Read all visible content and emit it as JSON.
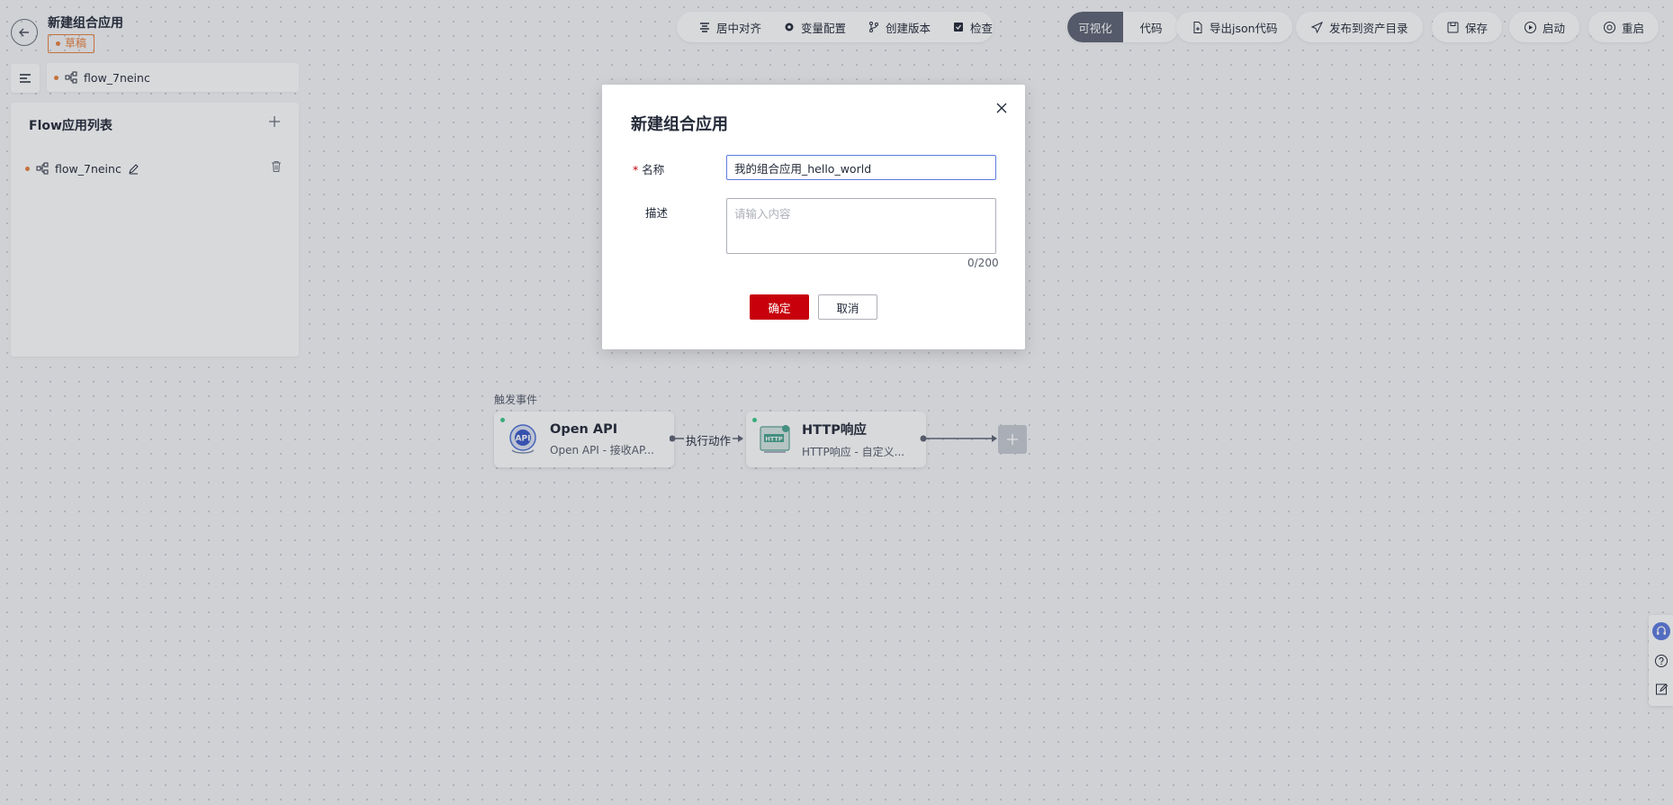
{
  "header": {
    "title": "新建组合应用",
    "status_badge": "草稿"
  },
  "toolbar": {
    "items": [
      {
        "label": "居中对齐",
        "icon": "align-center-icon"
      },
      {
        "label": "变量配置",
        "icon": "gear-icon"
      },
      {
        "label": "创建版本",
        "icon": "branch-icon"
      },
      {
        "label": "检查",
        "icon": "check-doc-icon"
      }
    ]
  },
  "view_toggle": {
    "visual": "可视化",
    "code": "代码",
    "active": "visual"
  },
  "actions": {
    "export_json": "导出json代码",
    "publish": "发布到资产目录",
    "save": "保存",
    "start": "启动",
    "restart": "重启"
  },
  "flow_tab": {
    "name": "flow_7neinc"
  },
  "left_panel": {
    "title": "Flow应用列表",
    "items": [
      {
        "name": "flow_7neinc"
      }
    ]
  },
  "canvas": {
    "trigger_label": "触发事件",
    "nodes": [
      {
        "title": "Open API",
        "subtitle": "Open API - 接收AP...",
        "icon": "api-icon"
      },
      {
        "title": "HTTP响应",
        "subtitle": "HTTP响应 - 自定义...",
        "icon": "http-icon"
      }
    ],
    "edge_label": "执行动作"
  },
  "modal": {
    "title": "新建组合应用",
    "name_label": "名称",
    "name_value": "我的组合应用_hello_world",
    "desc_label": "描述",
    "desc_placeholder": "请输入内容",
    "counter": "0/200",
    "ok_label": "确定",
    "cancel_label": "取消"
  },
  "colors": {
    "accent_red": "#c7000b",
    "draft_orange": "#e8803e",
    "focus_blue": "#5e7ce0",
    "toggle_active": "#5e6574"
  }
}
